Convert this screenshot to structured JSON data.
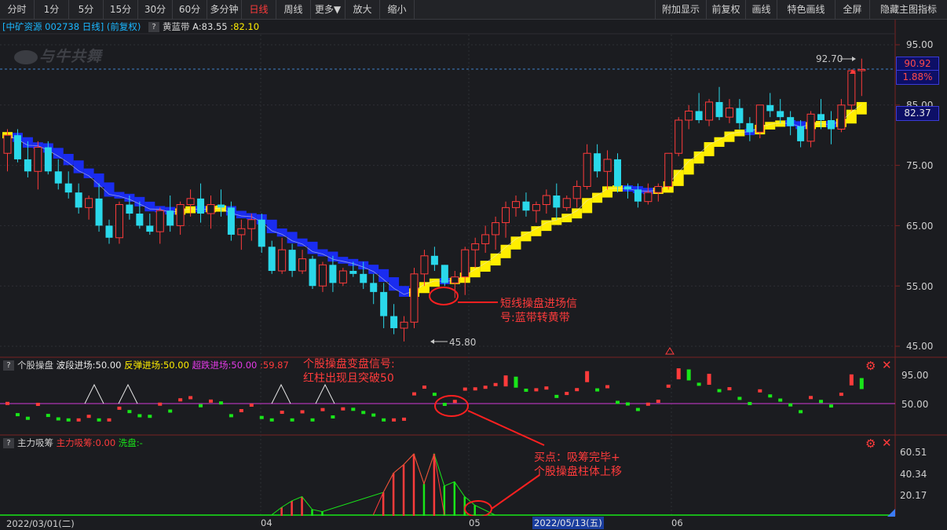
{
  "toolbar": {
    "left": [
      "分时",
      "1分",
      "5分",
      "15分",
      "30分",
      "60分",
      "多分钟",
      "日线",
      "周线",
      "更多▼",
      "放大",
      "缩小"
    ],
    "active": "日线",
    "right": [
      "附加显示",
      "前复权",
      "画线",
      "特色画线",
      "全屏",
      "隐藏主图指标"
    ]
  },
  "main_header": {
    "title": "[中矿资源 002738 日线] (前复权)",
    "indicator": "黄蓝带",
    "a_value": "A:83.55",
    "b_value": ":82.10"
  },
  "sub1_header": {
    "name": "个股操盘",
    "wave": "波段进场:50.00",
    "rebound": "反弹进场:50.00",
    "oversold": "超跌进场:50.00",
    "value": ":59.87"
  },
  "sub2_header": {
    "name": "主力吸筹",
    "absorb": "主力吸筹:0.00",
    "wash": "洗盘:-"
  },
  "watermark": "与牛共舞",
  "price_axis": {
    "ticks": [
      "95.00",
      "85.00",
      "75.00",
      "65.00",
      "55.00",
      "45.00"
    ],
    "current_price": "90.92",
    "change": "1.88%",
    "band_value": "82.37"
  },
  "sub1_axis": [
    "95.00",
    "50.00"
  ],
  "sub2_axis": [
    "60.51",
    "40.34",
    "20.17"
  ],
  "annotations": {
    "high": "92.70",
    "low": "45.80",
    "a1_line1": "短线操盘进场信",
    "a1_line2": "号:蓝带转黄带",
    "a2_line1": "个股操盘变盘信号:",
    "a2_line2": "红柱出现且突破50",
    "a3_line1": "买点：吸筹完毕+",
    "a3_line2": "个股操盘柱体上移"
  },
  "date_axis": {
    "start": "2022/03/01(二)",
    "apr": "04",
    "may": "05",
    "highlight": "2022/05/13(五)",
    "jun": "06"
  },
  "colors": {
    "up": "#ff3b3b",
    "down": "#2ad8ea",
    "band_up": "#ffee00",
    "band_down": "#1a2cf0",
    "green": "#19e619"
  },
  "chart_data": {
    "type": "candlestick",
    "candles": [
      [
        77,
        81,
        74,
        80
      ],
      [
        80,
        81,
        75.5,
        76
      ],
      [
        76,
        79,
        73,
        74
      ],
      [
        74,
        79,
        71,
        78
      ],
      [
        78,
        79,
        73.5,
        74
      ],
      [
        74,
        76,
        71,
        72
      ],
      [
        72,
        74,
        69.5,
        70.5
      ],
      [
        70.5,
        72,
        67,
        68
      ],
      [
        68,
        70,
        66,
        69.5
      ],
      [
        69.5,
        72,
        64,
        65
      ],
      [
        65,
        66,
        62,
        63
      ],
      [
        63,
        69,
        62,
        68.5
      ],
      [
        68.5,
        70,
        66,
        67
      ],
      [
        67,
        69,
        64.5,
        65
      ],
      [
        65,
        67,
        63.5,
        64
      ],
      [
        64,
        68,
        62,
        67.5
      ],
      [
        67.5,
        70,
        64,
        65
      ],
      [
        65,
        69,
        63.5,
        68.5
      ],
      [
        68.5,
        71,
        66.5,
        69.5
      ],
      [
        69.5,
        72,
        65.5,
        67
      ],
      [
        67,
        70,
        64.5,
        68.5
      ],
      [
        68.5,
        71,
        66.5,
        68
      ],
      [
        68,
        69,
        62.5,
        63.5
      ],
      [
        63.5,
        66,
        61,
        64.5
      ],
      [
        64.5,
        67,
        62.5,
        66
      ],
      [
        66,
        67,
        60.5,
        61.5
      ],
      [
        61.5,
        62.5,
        57,
        57.5
      ],
      [
        57.5,
        63,
        57,
        61
      ],
      [
        61,
        62,
        56.5,
        57.5
      ],
      [
        57.5,
        61,
        57,
        59.5
      ],
      [
        59.5,
        60,
        54.5,
        55
      ],
      [
        55,
        59,
        54,
        58.5
      ],
      [
        58.5,
        60,
        54,
        55.5
      ],
      [
        55.5,
        58,
        55,
        57.5
      ],
      [
        57.5,
        59,
        56.5,
        57
      ],
      [
        57,
        59,
        54.5,
        55.5
      ],
      [
        55.5,
        57,
        52,
        54
      ],
      [
        54,
        55.5,
        48,
        50
      ],
      [
        50,
        52,
        47,
        48
      ],
      [
        48,
        50,
        45.8,
        49
      ],
      [
        49,
        58,
        48,
        57
      ],
      [
        57,
        61,
        55,
        60
      ],
      [
        60,
        61.5,
        57.5,
        58.5
      ],
      [
        58.5,
        58.5,
        55,
        55.5
      ],
      [
        55.5,
        57.5,
        53,
        56.5
      ],
      [
        56.5,
        61.5,
        53.5,
        61
      ],
      [
        61,
        63,
        58,
        62
      ],
      [
        62,
        65,
        60.5,
        63.5
      ],
      [
        63.5,
        66.5,
        61,
        65.5
      ],
      [
        65.5,
        69,
        63,
        68
      ],
      [
        68,
        70,
        66.5,
        69
      ],
      [
        69,
        70.5,
        66.5,
        67.5
      ],
      [
        67.5,
        69,
        65.5,
        68.5
      ],
      [
        68.5,
        71,
        67,
        70
      ],
      [
        70,
        72,
        66,
        68
      ],
      [
        68,
        70,
        67.5,
        69.5
      ],
      [
        69.5,
        72.5,
        68,
        71.5
      ],
      [
        71.5,
        78.5,
        71,
        77
      ],
      [
        77,
        78.5,
        73,
        74
      ],
      [
        74,
        77.5,
        71,
        76
      ],
      [
        76,
        77,
        70.5,
        71.5
      ],
      [
        71.5,
        72,
        69.5,
        71
      ],
      [
        71,
        72,
        68,
        69
      ],
      [
        69,
        72,
        68.5,
        70.5
      ],
      [
        70.5,
        72,
        69,
        71.5
      ],
      [
        71.5,
        77,
        71,
        77
      ],
      [
        77,
        83,
        76.5,
        82.5
      ],
      [
        82.5,
        85,
        81,
        84
      ],
      [
        84,
        87,
        82,
        82.5
      ],
      [
        82.5,
        86,
        81.5,
        85.5
      ],
      [
        85.5,
        88,
        82.5,
        83
      ],
      [
        83,
        86,
        82,
        84.5
      ],
      [
        84.5,
        86,
        81,
        82
      ],
      [
        82,
        83,
        79,
        80.5
      ],
      [
        80.5,
        85,
        79.5,
        85
      ],
      [
        85,
        87,
        83,
        84
      ],
      [
        84,
        86,
        82,
        83
      ],
      [
        83,
        84,
        80,
        81.5
      ],
      [
        81.5,
        82.5,
        78,
        79
      ],
      [
        79,
        84,
        78,
        83.5
      ],
      [
        83.5,
        86,
        81,
        82.5
      ],
      [
        82.5,
        84,
        78.5,
        81
      ],
      [
        81,
        86,
        80.5,
        85
      ],
      [
        85,
        90.9,
        84,
        90.7
      ],
      [
        90.7,
        92.7,
        86.5,
        90.9
      ]
    ],
    "price_range": [
      45,
      98
    ]
  }
}
